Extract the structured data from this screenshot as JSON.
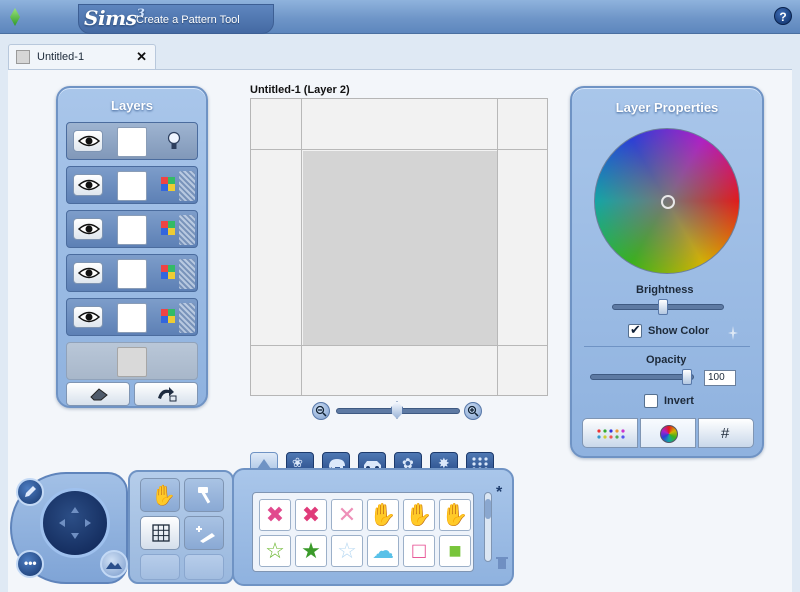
{
  "window": {
    "logo_text": "Sims",
    "logo_version": "3",
    "tool_title": "Create a Pattern Tool",
    "help_label": "?"
  },
  "document_tab": {
    "label": "Untitled-1",
    "close_label": "✕"
  },
  "layers_panel": {
    "title": "Layers",
    "rows": [
      {
        "state": "selected",
        "channel": "bulb"
      },
      {
        "state": "normal",
        "channel": "multi"
      },
      {
        "state": "normal",
        "channel": "multi"
      },
      {
        "state": "normal",
        "channel": "multi"
      },
      {
        "state": "normal",
        "channel": "multi"
      },
      {
        "state": "empty",
        "channel": "none"
      }
    ],
    "buttons": [
      "eraser-icon",
      "undo-layer-icon"
    ]
  },
  "canvas": {
    "title": "Untitled-1 (Layer 2)",
    "zoom_level": 0.5
  },
  "layer_properties": {
    "title": "Layer Properties",
    "brightness_label": "Brightness",
    "brightness_value": 0.4,
    "show_color_label": "Show Color",
    "show_color_checked": true,
    "opacity_label": "Opacity",
    "opacity_value": "100",
    "invert_label": "Invert",
    "invert_checked": false,
    "tabs": [
      {
        "icon": "palette-dots-icon"
      },
      {
        "icon": "color-wheel-icon"
      },
      {
        "icon": "hash-icon",
        "label": "#"
      }
    ]
  },
  "stamp_panel": {
    "category_tabs": [
      "shapes",
      "patterns",
      "animals",
      "vehicles",
      "flowers",
      "stars",
      "dots"
    ],
    "stamps": [
      {
        "glyph": "✖",
        "color": "#e14a8e"
      },
      {
        "glyph": "✖",
        "color": "#e03b7a"
      },
      {
        "glyph": "✕",
        "color": "#ee8fb8"
      },
      {
        "glyph": "✋",
        "color": "#f08ab0"
      },
      {
        "glyph": "✋",
        "color": "#f2c44a"
      },
      {
        "glyph": "✋",
        "color": "#ea7fa8"
      },
      {
        "glyph": "☆",
        "color": "#67b52a"
      },
      {
        "glyph": "★",
        "color": "#3a9a2a"
      },
      {
        "glyph": "☆",
        "color": "#b7d8f2"
      },
      {
        "glyph": "☁",
        "color": "#59c1e8"
      },
      {
        "glyph": "□",
        "color": "#e6458c"
      },
      {
        "glyph": "■",
        "color": "#78c53b"
      }
    ]
  },
  "colors": {
    "panel_blue": "#8fb2df",
    "title_bar": "#6f96c8",
    "accent_dark": "#2a4f8c"
  }
}
